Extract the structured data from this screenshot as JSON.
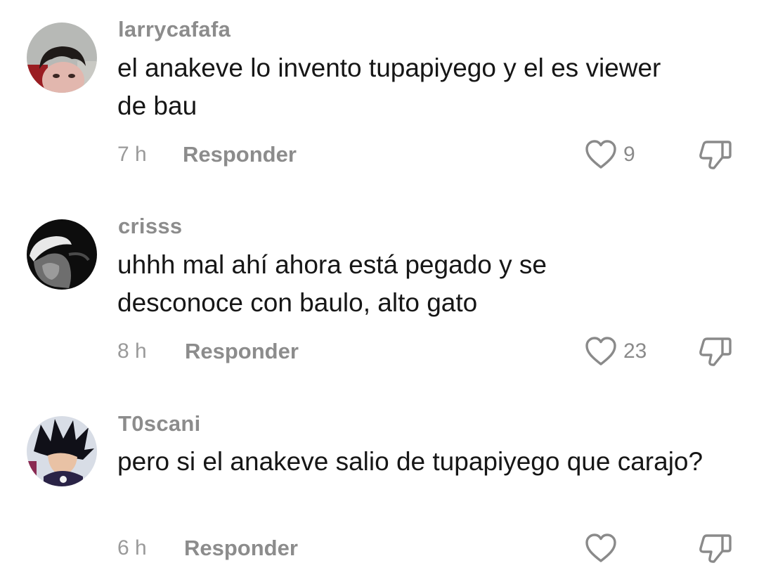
{
  "comments": [
    {
      "username": "larrycafafa",
      "text": "el anakeve lo invento tupapiyego y el es viewer de bau",
      "time": "7 h",
      "reply_label": "Responder",
      "likes": "9",
      "avatar": "person-face-photo"
    },
    {
      "username": "crisss",
      "text": "uhhh mal ahí ahora está pegado y se desconoce con baulo, alto gato",
      "time": "8 h",
      "reply_label": "Responder",
      "likes": "23",
      "avatar": "bw-person-cap-photo"
    },
    {
      "username": "T0scani",
      "text": "pero si el anakeve salio de tupapiyego que carajo?",
      "time": "6 h",
      "reply_label": "Responder",
      "likes": "",
      "avatar": "anime-character-drawing"
    }
  ],
  "icons": {
    "like": "heart-outline-icon",
    "dislike": "thumbs-down-outline-icon"
  },
  "colors": {
    "text": "#161616",
    "muted": "#8c8c8c"
  }
}
